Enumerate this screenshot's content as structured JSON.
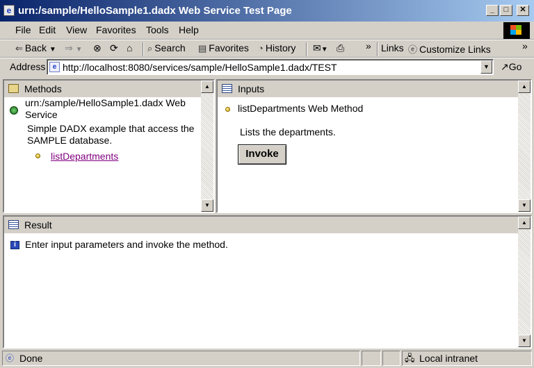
{
  "window": {
    "title": "urn:/sample/HelloSample1.dadx Web Service Test Page",
    "app_icon": "ie-page-icon",
    "buttons": [
      "minimize",
      "maximize",
      "close"
    ]
  },
  "menu": {
    "items": [
      {
        "label": "File"
      },
      {
        "label": "Edit"
      },
      {
        "label": "View"
      },
      {
        "label": "Favorites"
      },
      {
        "label": "Tools"
      },
      {
        "label": "Help"
      }
    ]
  },
  "toolbar": {
    "back_label": "Back",
    "search_label": "Search",
    "favorites_label": "Favorites",
    "history_label": "History",
    "links_label": "Links",
    "customize_links_label": "Customize Links",
    "chevron": "»"
  },
  "address": {
    "label": "Address",
    "url": "http://localhost:8080/services/sample/HelloSample1.dadx/TEST",
    "go_label": "Go"
  },
  "methods_frame": {
    "title": "Methods",
    "service_name": "urn:/sample/HelloSample1.dadx Web Service",
    "description": "Simple DADX example that access the SAMPLE database.",
    "methods": [
      {
        "label": "listDepartments"
      }
    ]
  },
  "inputs_frame": {
    "title": "Inputs",
    "method_title": "listDepartments Web Method",
    "method_description": "Lists the departments.",
    "invoke_label": "Invoke"
  },
  "result_frame": {
    "title": "Result",
    "message": "Enter input parameters and invoke the method."
  },
  "status": {
    "text": "Done",
    "zone": "Local intranet"
  }
}
